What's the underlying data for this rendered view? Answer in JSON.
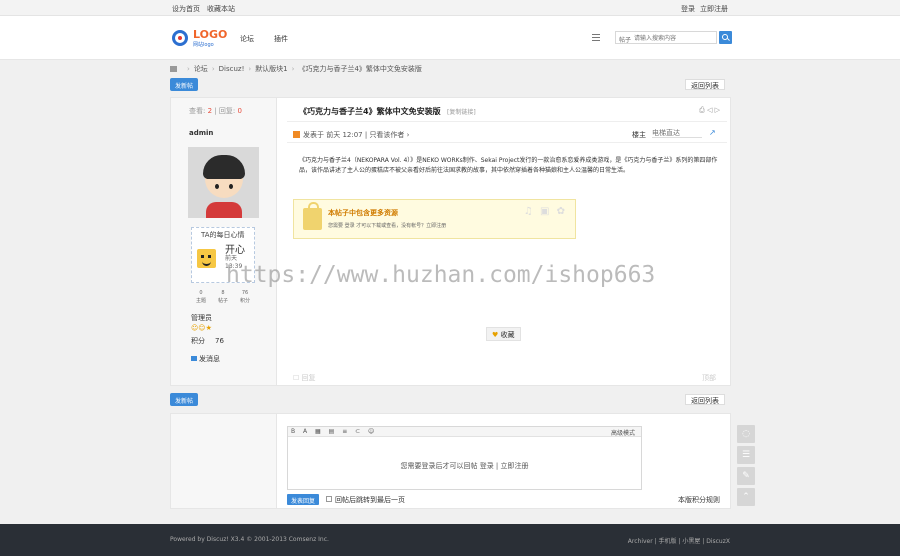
{
  "topbar": {
    "set_home": "设为首页",
    "bookmark": "收藏本站",
    "login": "登录",
    "register": "立即注册"
  },
  "header": {
    "logo": "LOGO",
    "logo_sub": "网站logo",
    "nav_forum": "论坛",
    "nav_plugin": "插件",
    "search_category": "帖子",
    "search_placeholder": "请输入搜索内容"
  },
  "breadcrumb": [
    "论坛",
    "Discuz!",
    "默认版块1",
    "《巧克力与香子兰4》繁体中文免安装版"
  ],
  "actions": {
    "new_post": "发新帖",
    "back_list": "返回列表"
  },
  "side": {
    "views_label": "查看:",
    "views": "2",
    "replies_label": "回复:",
    "replies": "0",
    "author": "admin",
    "mood_title": "TA的每日心情",
    "mood": "开心",
    "mood_time": "前天 13:39",
    "stats": [
      {
        "v": "0",
        "k": "主题"
      },
      {
        "v": "8",
        "k": "帖子"
      },
      {
        "v": "76",
        "k": "积分"
      }
    ],
    "role": "管理员",
    "stars": "☺☺★",
    "credit_label": "积分",
    "credit": "76",
    "message": "发消息"
  },
  "post": {
    "title": "《巧克力与香子兰4》繁体中文免安装版",
    "copy_link": "[复制链接]",
    "posted": "发表于 前天 12:07",
    "author_only": "只看该作者",
    "floor": "楼主",
    "floor_input": "电梯直达",
    "content": "《巧克力与香子兰4（NEKOPARA Vol. 4）》是NEKO WORKs制作、Sekai Project发行的一款治愈系恋爱养成类游戏，是《巧克力与香子兰》系列的第四部作品，该作品讲述了主人公的蛋糕店不被父亲看好后前往法国求教的故事，其中依然穿插着各种猫娘和主人公温馨的日常生活。",
    "hidden_title": "本帖子中包含更多资源",
    "hidden_text": "您需要 登录 才可以下载或查看，没有帐号？立即注册",
    "favorite": "收藏",
    "reply": "回复",
    "top": "顶部"
  },
  "reply": {
    "mode": "高级模式",
    "need_login": "您需要登录后才可以回帖 登录 | 立即注册",
    "submit": "发表回复",
    "jump": "回帖后跳转到最后一页",
    "rules": "本版积分规则"
  },
  "footer": {
    "powered": "Powered by Discuz! X3.4 © 2001-2013 Comsenz Inc.",
    "links": "Archiver | 手机版 | 小黑屋 | DiscuzX"
  },
  "watermark": "https://www.huzhan.com/ishop663"
}
